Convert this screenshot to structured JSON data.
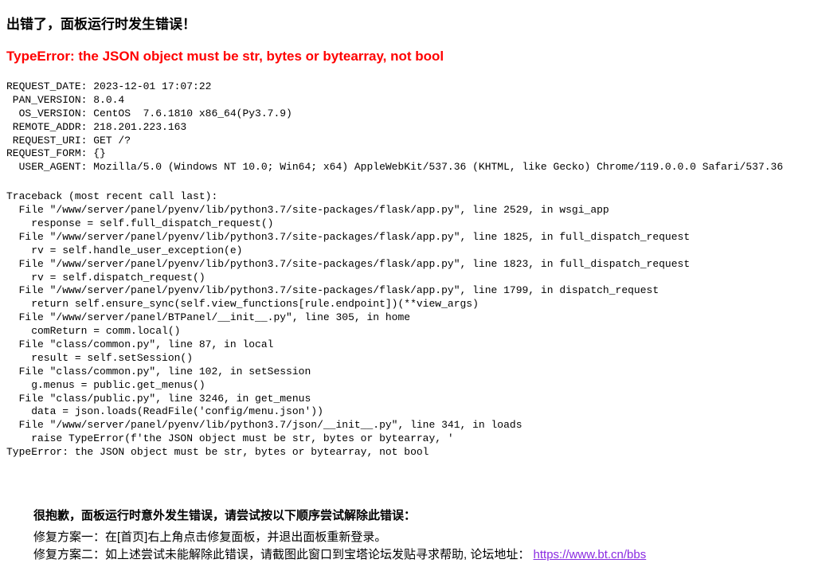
{
  "title": "出错了，面板运行时发生错误！",
  "error_type": "TypeError: the JSON object must be str, bytes or bytearray, not bool",
  "request_info": "REQUEST_DATE: 2023-12-01 17:07:22\n PAN_VERSION: 8.0.4\n  OS_VERSION: CentOS  7.6.1810 x86_64(Py3.7.9)\n REMOTE_ADDR: 218.201.223.163\n REQUEST_URI: GET /?\nREQUEST_FORM: {}\n  USER_AGENT: Mozilla/5.0 (Windows NT 10.0; Win64; x64) AppleWebKit/537.36 (KHTML, like Gecko) Chrome/119.0.0.0 Safari/537.36",
  "traceback": "Traceback (most recent call last):\n  File \"/www/server/panel/pyenv/lib/python3.7/site-packages/flask/app.py\", line 2529, in wsgi_app\n    response = self.full_dispatch_request()\n  File \"/www/server/panel/pyenv/lib/python3.7/site-packages/flask/app.py\", line 1825, in full_dispatch_request\n    rv = self.handle_user_exception(e)\n  File \"/www/server/panel/pyenv/lib/python3.7/site-packages/flask/app.py\", line 1823, in full_dispatch_request\n    rv = self.dispatch_request()\n  File \"/www/server/panel/pyenv/lib/python3.7/site-packages/flask/app.py\", line 1799, in dispatch_request\n    return self.ensure_sync(self.view_functions[rule.endpoint])(**view_args)\n  File \"/www/server/panel/BTPanel/__init__.py\", line 305, in home\n    comReturn = comm.local()\n  File \"class/common.py\", line 87, in local\n    result = self.setSession()\n  File \"class/common.py\", line 102, in setSession\n    g.menus = public.get_menus()\n  File \"class/public.py\", line 3246, in get_menus\n    data = json.loads(ReadFile('config/menu.json'))\n  File \"/www/server/panel/pyenv/lib/python3.7/json/__init__.py\", line 341, in loads\n    raise TypeError(f'the JSON object must be str, bytes or bytearray, '\nTypeError: the JSON object must be str, bytes or bytearray, not bool",
  "footer": {
    "apology": "很抱歉，面板运行时意外发生错误，请尝试按以下顺序尝试解除此错误：",
    "fix1": "修复方案一：在[首页]右上角点击修复面板，并退出面板重新登录。",
    "fix2_prefix": "修复方案二：如上述尝试未能解除此错误，请截图此窗口到宝塔论坛发贴寻求帮助, 论坛地址：",
    "link_text": "https://www.bt.cn/bbs",
    "link_href": "https://www.bt.cn/bbs"
  }
}
